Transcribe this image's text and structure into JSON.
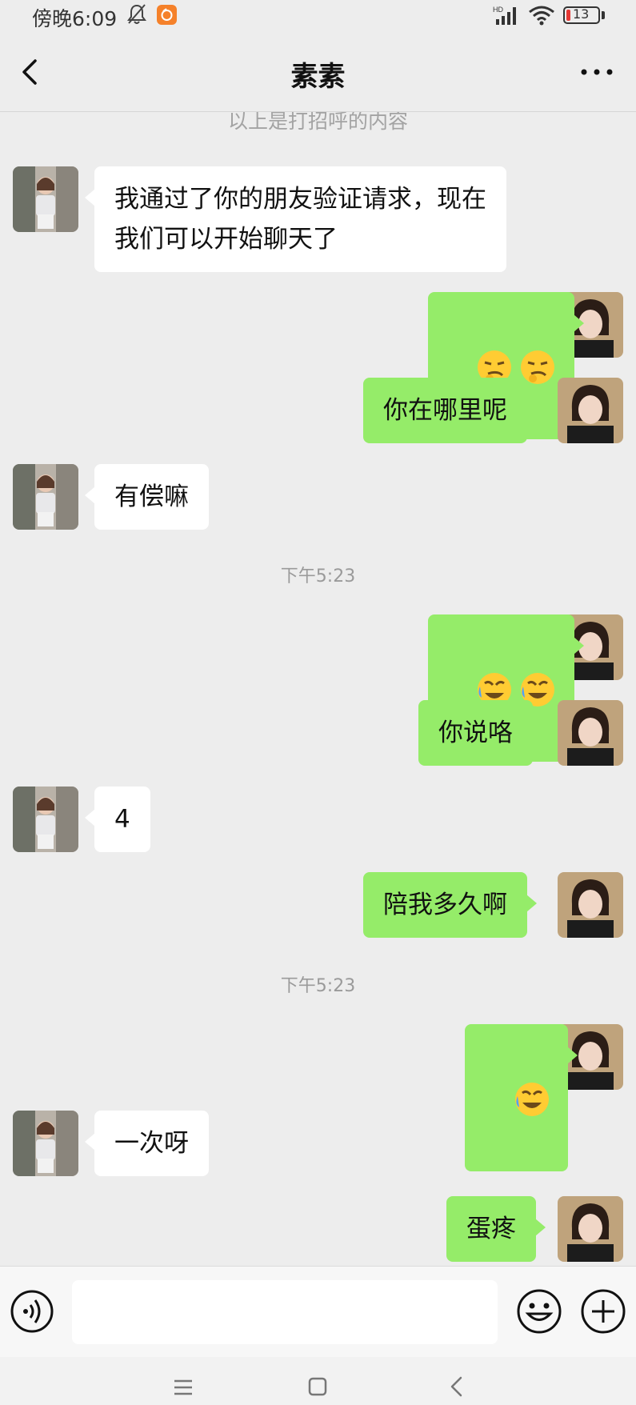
{
  "status_bar": {
    "time": "傍晚6:09",
    "network": "HD",
    "battery_level": "13",
    "icons": [
      "mute-bell-icon",
      "app-notification-icon",
      "signal-icon",
      "wifi-icon",
      "battery-icon"
    ]
  },
  "header": {
    "title": "素素",
    "back_icon": "chevron-left-icon",
    "more_icon": "more-dots-icon"
  },
  "conversation": {
    "system_note": "以上是打招呼的内容",
    "timestamps": [
      "下午5:23",
      "下午5:23"
    ],
    "messages": [
      {
        "from": "contact",
        "text": "我通过了你的朋友验证请求，现在\n我们可以开始聊天了"
      },
      {
        "from": "me",
        "emoji": [
          "smirk-face-emoji",
          "smirk-face-emoji"
        ]
      },
      {
        "from": "me",
        "text": "你在哪里呢"
      },
      {
        "from": "contact",
        "text": "有偿嘛"
      },
      {
        "from": "me",
        "emoji": [
          "crying-laughing-emoji",
          "crying-laughing-emoji"
        ]
      },
      {
        "from": "me",
        "text": "你说咯"
      },
      {
        "from": "contact",
        "text": "4"
      },
      {
        "from": "me",
        "text": "陪我多久啊"
      },
      {
        "from": "me",
        "emoji": [
          "crying-laughing-emoji"
        ]
      },
      {
        "from": "contact",
        "text": "一次呀"
      },
      {
        "from": "me",
        "text": "蛋疼"
      }
    ]
  },
  "input_bar": {
    "value": "",
    "icons": [
      "voice-icon",
      "emoji-face-icon",
      "plus-icon"
    ]
  },
  "nav_bar": {
    "icons": [
      "menu-lines-icon",
      "home-square-icon",
      "back-chevron-icon"
    ]
  },
  "colors": {
    "background": "#ededed",
    "my_bubble": "#95ec69",
    "their_bubble": "#ffffff",
    "battery_low": "#e53935"
  }
}
